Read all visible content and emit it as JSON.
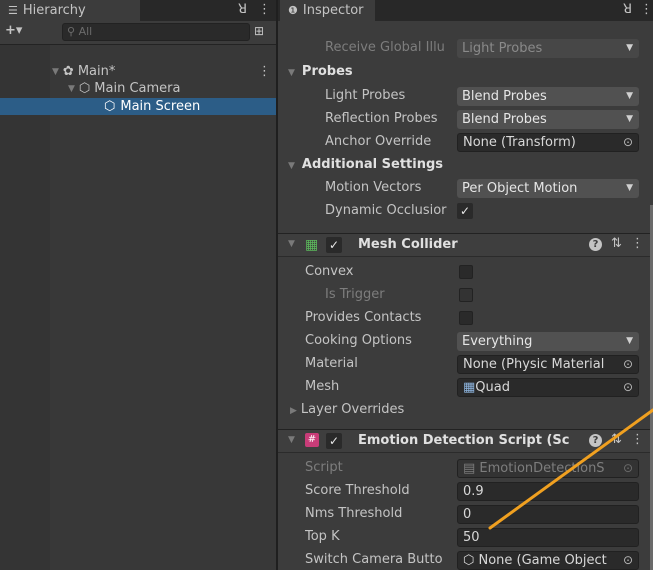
{
  "hierarchy": {
    "tab_label": "Hierarchy",
    "lock_glyph": "ꓤ",
    "menu_glyph": "⋮",
    "add_glyph": "+▾",
    "search_placeholder": "All",
    "items": [
      {
        "label": "Main*",
        "menu": "⋮"
      },
      {
        "label": "Main Camera"
      },
      {
        "label": "Main Screen"
      }
    ]
  },
  "inspector": {
    "tab_label": "Inspector",
    "lock_glyph": "ꓤ",
    "menu_glyph": "⋮",
    "rows_top": [
      {
        "label": "Receive Global Illu",
        "value": "Light Probes"
      }
    ],
    "probes": {
      "title": "Probes",
      "light_probes": {
        "label": "Light Probes",
        "value": "Blend Probes"
      },
      "reflection_probes": {
        "label": "Reflection Probes",
        "value": "Blend Probes"
      },
      "anchor_override": {
        "label": "Anchor Override",
        "value": "None (Transform)"
      }
    },
    "additional": {
      "title": "Additional Settings",
      "motion_vectors": {
        "label": "Motion Vectors",
        "value": "Per Object Motion"
      },
      "dynamic_occlusion": {
        "label": "Dynamic Occlusior",
        "checked": true
      }
    },
    "mesh_collider": {
      "title": "Mesh Collider",
      "convex": "Convex",
      "is_trigger": "Is Trigger",
      "provides_contacts": "Provides Contacts",
      "cooking_options": {
        "label": "Cooking Options",
        "value": "Everything"
      },
      "material": {
        "label": "Material",
        "value": "None (Physic Material"
      },
      "mesh": {
        "label": "Mesh",
        "value": "Quad"
      },
      "layer_overrides": "Layer Overrides"
    },
    "emotion_script": {
      "title": "Emotion Detection Script (Sc",
      "script": {
        "label": "Script",
        "value": "EmotionDetectionS"
      },
      "score_threshold": {
        "label": "Score Threshold",
        "value": "0.9"
      },
      "nms_threshold": {
        "label": "Nms Threshold",
        "value": "0"
      },
      "top_k": {
        "label": "Top K",
        "value": "50"
      },
      "switch_camera": {
        "label": "Switch Camera Butto",
        "value": "None (Game Object"
      }
    },
    "glyphs": {
      "check": "✓",
      "help": "?",
      "settings": "⇅",
      "more": "⋮",
      "target": "⊙",
      "dropdown": "▼"
    }
  },
  "colors": {
    "selection": "#2c5d87",
    "annotation_arrow": "#f0a020",
    "component_icon_green": "#5cb85c",
    "script_icon_pink": "#c83c78"
  }
}
